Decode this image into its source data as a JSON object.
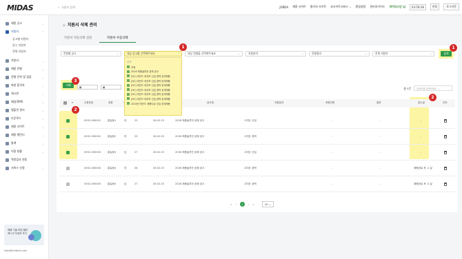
{
  "topbar": {
    "logo": "MIDAS",
    "search_placeholder": "지원자 검색",
    "nav": [
      "JOBDA",
      "채용 사이트",
      "평가자 사이트",
      "요사이트서비스 ⌄",
      "환경설정",
      "관리자가이드"
    ],
    "user": "마이다스인 님",
    "time": "03:59:28",
    "extend": "연장",
    "logout": "로그아웃"
  },
  "sidebar": {
    "items": [
      {
        "label": "채용 공고",
        "expanded": false
      },
      {
        "label": "지원자",
        "expanded": true,
        "active": true
      },
      {
        "label": "공고별 지원자",
        "sub": true
      },
      {
        "label": "응시 지원자",
        "sub": true
      },
      {
        "label": "전체 지원자",
        "sub": true
      },
      {
        "label": "지원서",
        "expanded": false
      },
      {
        "label": "채용 전형",
        "expanded": false
      },
      {
        "label": "전형 진척 및 점검",
        "expanded": false
      },
      {
        "label": "회원 합격자",
        "expanded": false
      },
      {
        "label": "게시판",
        "expanded": false
      },
      {
        "label": "메일/SMS",
        "expanded": false
      },
      {
        "label": "템플릿 관리",
        "expanded": false
      },
      {
        "label": "다운로드",
        "expanded": false
      },
      {
        "label": "채용 사이트",
        "expanded": false
      },
      {
        "label": "채용 캘린더",
        "expanded": false
      },
      {
        "label": "통계",
        "expanded": false
      },
      {
        "label": "이용 현황",
        "expanded": false
      },
      {
        "label": "역량검사 연동",
        "expanded": false
      },
      {
        "label": "서비스 신청",
        "expanded": false
      }
    ],
    "banner_text": "채용 기술 마련 챌린 캐스크 자세히 보기",
    "email": "help@midasin.com"
  },
  "page": {
    "title": "지원서 삭제 관리",
    "tabs": [
      "지원서 자동삭제 설정",
      "지원서 수동삭제"
    ],
    "active_tab": 1
  },
  "filters": {
    "f1": "전형별 공고",
    "f2": "대상 공고를 선택해주세요",
    "f3": "대상 전형을 선택해주세요",
    "f4": "지원분야",
    "f5": "전형결과",
    "f6": "전체 지원자",
    "search_button": "검색",
    "delete_button": "삭제",
    "dropdown_placeholder": "검색",
    "dropdown_items": [
      "전체",
      "2026 채용솔루션 공채 공고",
      "[DC] 마인드 대규모 신입 경력 공개채용",
      "[DC] 마인드 대규모 신입 경력 공개채용",
      "[DC] 마인드 대규모 신입 경력 공개채용",
      "[DC] 마인드 대규모 신입 경력 공개채용",
      "[DC] 마인드 대규모 신입 경력 공개채용",
      "[DC] 마인드 대규모 신입 경력 공개채용",
      "2026년 마인드 채용다큐 신입 공개채용"
    ]
  },
  "table": {
    "count": "총 5건",
    "search_placeholder": "검색어를 입력하세요",
    "headers": [
      "",
      "수험번호",
      "성명",
      "성별",
      "나이",
      "지원일",
      "공고명",
      "지원분야",
      "최종전형",
      "결과",
      "접수일",
      "관리"
    ],
    "rows": [
      {
        "id": "0052-000001",
        "name": "홍길동1",
        "gender": "여",
        "age": "25",
        "date": "26.02.25",
        "posting": "2026 채용솔루션 공채 공고",
        "field": "1지망: 신입",
        "stage": "-",
        "result": "-",
        "received": "-",
        "checked": true
      },
      {
        "id": "0052-000002",
        "name": "홍길동2",
        "gender": "여",
        "age": "25",
        "date": "26.02.25",
        "posting": "2026 채용솔루션 공채 공고",
        "field": "1지망: 경력",
        "stage": "-",
        "result": "-",
        "received": "-",
        "checked": true
      },
      {
        "id": "0052-000003",
        "name": "홍길동3",
        "gender": "남",
        "age": "27",
        "date": "26.02.25",
        "posting": "2026 채용솔루션 공채 공고",
        "field": "1지망: 신입",
        "stage": "-",
        "result": "-",
        "received": "-",
        "checked": true
      },
      {
        "id": "0052-000004",
        "name": "홍길동4",
        "gender": "여",
        "age": "28",
        "date": "26.02.25",
        "posting": "2026 채용솔루션 공채 공고",
        "field": "1지망: 경력",
        "stage": "-",
        "result": "-",
        "received": "채용완료 후 -2 일",
        "checked": false
      },
      {
        "id": "0052-000005",
        "name": "홍길동5",
        "gender": "남",
        "age": "27",
        "date": "26.02.25",
        "posting": "2026 채용솔루션 공채 공고",
        "field": "1지망: 경력",
        "stage": "-",
        "result": "-",
        "received": "채용완료 후 -5 일",
        "checked": false
      }
    ]
  },
  "pagination": {
    "prev_first": "«",
    "prev": "‹",
    "current": "1",
    "next": "›",
    "next_last": "»",
    "page_size": "10"
  },
  "annotations": {
    "b1": "1",
    "b1b": "1",
    "b2": "2",
    "b2b": "2",
    "b3": "3"
  },
  "colors": {
    "accent": "#2f9b4b",
    "highlight": "#fcf5a3",
    "badge": "#d42a2a"
  }
}
